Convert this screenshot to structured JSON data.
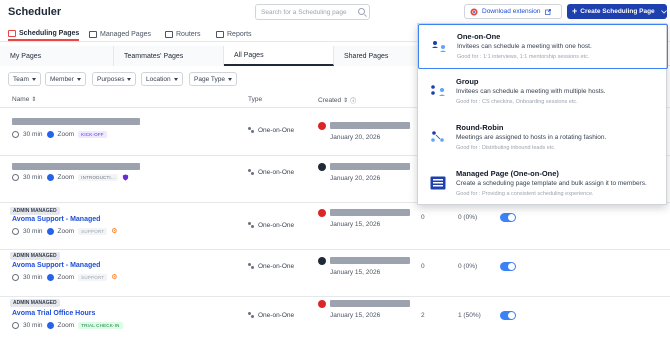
{
  "header": {
    "title": "Scheduler",
    "search_placeholder": "Search for a Scheduling page",
    "download_label": "Download extension",
    "create_label": "Create Scheduling Page"
  },
  "nav_tabs": [
    {
      "label": "Scheduling Pages",
      "active": true
    },
    {
      "label": "Managed Pages"
    },
    {
      "label": "Routers"
    },
    {
      "label": "Reports"
    }
  ],
  "sub_tabs": [
    "My Pages",
    "Teammates' Pages",
    "All Pages",
    "Shared Pages"
  ],
  "filters": [
    "Team",
    "Member",
    "Purposes",
    "Location",
    "Page Type"
  ],
  "table_headers": {
    "name": "Name",
    "type": "Type",
    "created": "Created"
  },
  "rows": [
    {
      "admin": "",
      "title": "",
      "duration": "30 min",
      "location": "Zoom",
      "tag": "KICK-OFF",
      "type": "One-on-One",
      "date": "January 20, 2026",
      "col1": "",
      "col2": ""
    },
    {
      "admin": "",
      "title": "",
      "duration": "30 min",
      "location": "Zoom",
      "tag": "INTRODUCTI...",
      "type": "One-on-One",
      "date": "January 20, 2026",
      "col1": "",
      "col2": ""
    },
    {
      "admin": "ADMIN MANAGED",
      "title": "Avoma Support - Managed",
      "duration": "30 min",
      "location": "Zoom",
      "tag": "SUPPORT",
      "type": "One-on-One",
      "date": "January 15, 2026",
      "col1": "0",
      "col2": "0 (0%)"
    },
    {
      "admin": "ADMIN MANAGED",
      "title": "Avoma Support - Managed",
      "duration": "30 min",
      "location": "Zoom",
      "tag": "SUPPORT",
      "type": "One-on-One",
      "date": "January 15, 2026",
      "col1": "0",
      "col2": "0 (0%)"
    },
    {
      "admin": "ADMIN MANAGED",
      "title": "Avoma Trial Office Hours",
      "duration": "30 min",
      "location": "Zoom",
      "tag": "TRIAL CHECK-IN",
      "type": "One-on-One",
      "date": "January 15, 2026",
      "col1": "2",
      "col2": "1 (50%)"
    }
  ],
  "dropdown": [
    {
      "title": "One-on-One",
      "desc": "Invitees can schedule a meeting with one host.",
      "good": "Good for : 1:1 interviews, 1:1 mentorship sessions etc."
    },
    {
      "title": "Group",
      "desc": "Invitees can schedule a meeting with multiple hosts.",
      "good": "Good for : CS checkins, Onboarding sessions etc."
    },
    {
      "title": "Round-Robin",
      "desc": "Meetings are assigned to hosts in a rotating fashion.",
      "good": "Good for : Distributing inbound leads etc."
    },
    {
      "title": "Managed Page (One-on-One)",
      "desc": "Create a scheduling page template and bulk assign it to members.",
      "good": "Good for : Providing a consistent scheduling experience."
    }
  ],
  "colors": {
    "primary": "#1e40af",
    "accent_red": "#ef4444",
    "link": "#1d4ed8",
    "toggle": "#3b82f6"
  }
}
